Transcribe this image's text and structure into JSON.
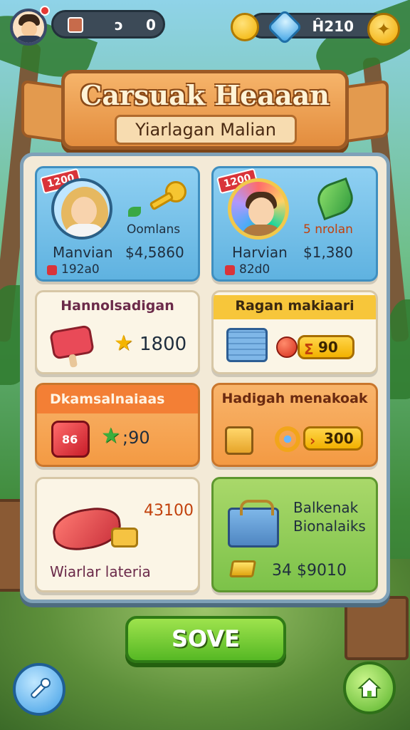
{
  "hud": {
    "left_value_a": "ɔ",
    "left_value_b": "0",
    "right_value": "Ĥ210",
    "star_badge_icon": "star-badge-icon"
  },
  "banner": {
    "title": "Carsuak Heaaan",
    "subtitle": "Yiarlagan Malian"
  },
  "cards": {
    "card1": {
      "tag": "1200",
      "icon_label": "Oomlans",
      "name": "Manvian",
      "price": "$4,5860",
      "stat": "192a0"
    },
    "card2": {
      "tag": "1200",
      "icon_label": "5 nrolan",
      "name": "Harvian",
      "price": "$1,380",
      "stat": "82d0"
    },
    "card3": {
      "title": "Hannolsadigan",
      "value": "1800"
    },
    "card4": {
      "title": "Ragan makiaari",
      "value": "90"
    },
    "card5": {
      "title": "Dkamsalnaiaas",
      "value": ";90"
    },
    "card6": {
      "title": "Hadigah menakoak",
      "value": "300"
    },
    "card7": {
      "value": "43100",
      "label": "Wiarlar lateria"
    },
    "card8": {
      "title_line1": "Balkenak",
      "title_line2": "Bionalaiks",
      "value": "34 $9010"
    }
  },
  "buttons": {
    "save_label": "SOVE"
  },
  "colors": {
    "panel_border": "#7fa1b8",
    "banner": "#e38d3e",
    "save_button": "#56b824",
    "card_blue": "#5fb2e0",
    "card_orange": "#f49a43",
    "card_green": "#7cc249"
  }
}
